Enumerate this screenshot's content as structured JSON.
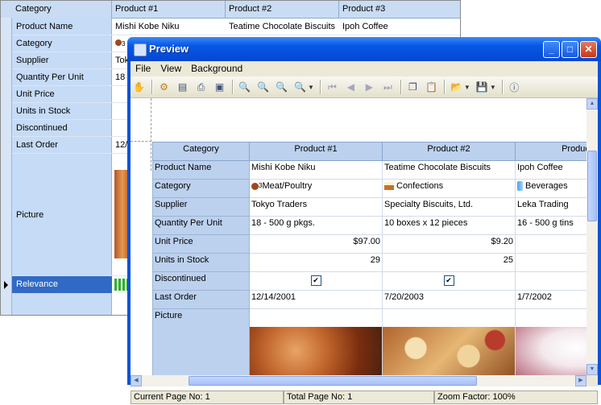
{
  "background_grid": {
    "headers": [
      "Category",
      "Product #1",
      "Product #2",
      "Product #3"
    ],
    "rows": [
      {
        "label": "Product Name",
        "values": [
          "Mishi Kobe Niku",
          "Teatime Chocolate Biscuits",
          "Ipoh Coffee"
        ]
      },
      {
        "label": "Category",
        "values": [
          "3",
          "",
          ""
        ]
      },
      {
        "label": "Supplier",
        "values": [
          "Tok",
          "",
          ""
        ]
      },
      {
        "label": "Quantity Per Unit",
        "values": [
          "18",
          "",
          ""
        ]
      },
      {
        "label": "Unit Price",
        "values": [
          "",
          "",
          ""
        ]
      },
      {
        "label": "Units in Stock",
        "values": [
          "",
          "",
          ""
        ]
      },
      {
        "label": "Discontinued",
        "values": [
          "",
          "",
          ""
        ]
      },
      {
        "label": "Last Order",
        "values": [
          "12/",
          "",
          ""
        ]
      }
    ],
    "picture_label": "Picture",
    "selected_label": "Relevance"
  },
  "preview": {
    "title": "Preview",
    "menu": [
      "File",
      "View",
      "Background"
    ],
    "toolbar_icons": [
      "hand-icon",
      "gear-icon",
      "page-setup-icon",
      "print-icon",
      "export-icon",
      "zoom-icon",
      "zoom-in-icon",
      "zoom-out-icon",
      "zoom-menu-icon",
      "first-page-icon",
      "prev-page-icon",
      "next-page-icon",
      "last-page-icon",
      "copy-icon",
      "paste-icon",
      "open-icon",
      "save-icon",
      "about-icon"
    ],
    "table": {
      "headers": [
        "Category",
        "Product #1",
        "Product #2",
        "Produc"
      ],
      "product_name": {
        "label": "Product Name",
        "values": [
          "Mishi Kobe Niku",
          "Teatime Chocolate Biscuits",
          "Ipoh Coffee"
        ]
      },
      "category": {
        "label": "Category",
        "values": [
          "Meat/Poultry",
          "Confections",
          "Beverages"
        ],
        "icon_numbers": [
          "3",
          "",
          ""
        ]
      },
      "supplier": {
        "label": "Supplier",
        "values": [
          "Tokyo Traders",
          "Specialty Biscuits, Ltd.",
          "Leka Trading"
        ]
      },
      "quantity": {
        "label": "Quantity Per Unit",
        "values": [
          "18 - 500 g pkgs.",
          "10 boxes x 12 pieces",
          "16 - 500 g tins"
        ]
      },
      "unit_price": {
        "label": "Unit Price",
        "values": [
          "$97.00",
          "$9.20",
          ""
        ]
      },
      "units_in_stock": {
        "label": "Units in Stock",
        "values": [
          "29",
          "25",
          ""
        ]
      },
      "discontinued": {
        "label": "Discontinued",
        "values": [
          true,
          true,
          true
        ]
      },
      "last_order": {
        "label": "Last Order",
        "values": [
          "12/14/2001",
          "7/20/2003",
          "1/7/2002"
        ]
      },
      "picture": {
        "label": "Picture"
      }
    },
    "status": {
      "current_page": "Current Page No: 1",
      "total_page": "Total Page No: 1",
      "zoom": "Zoom Factor: 100%"
    }
  }
}
